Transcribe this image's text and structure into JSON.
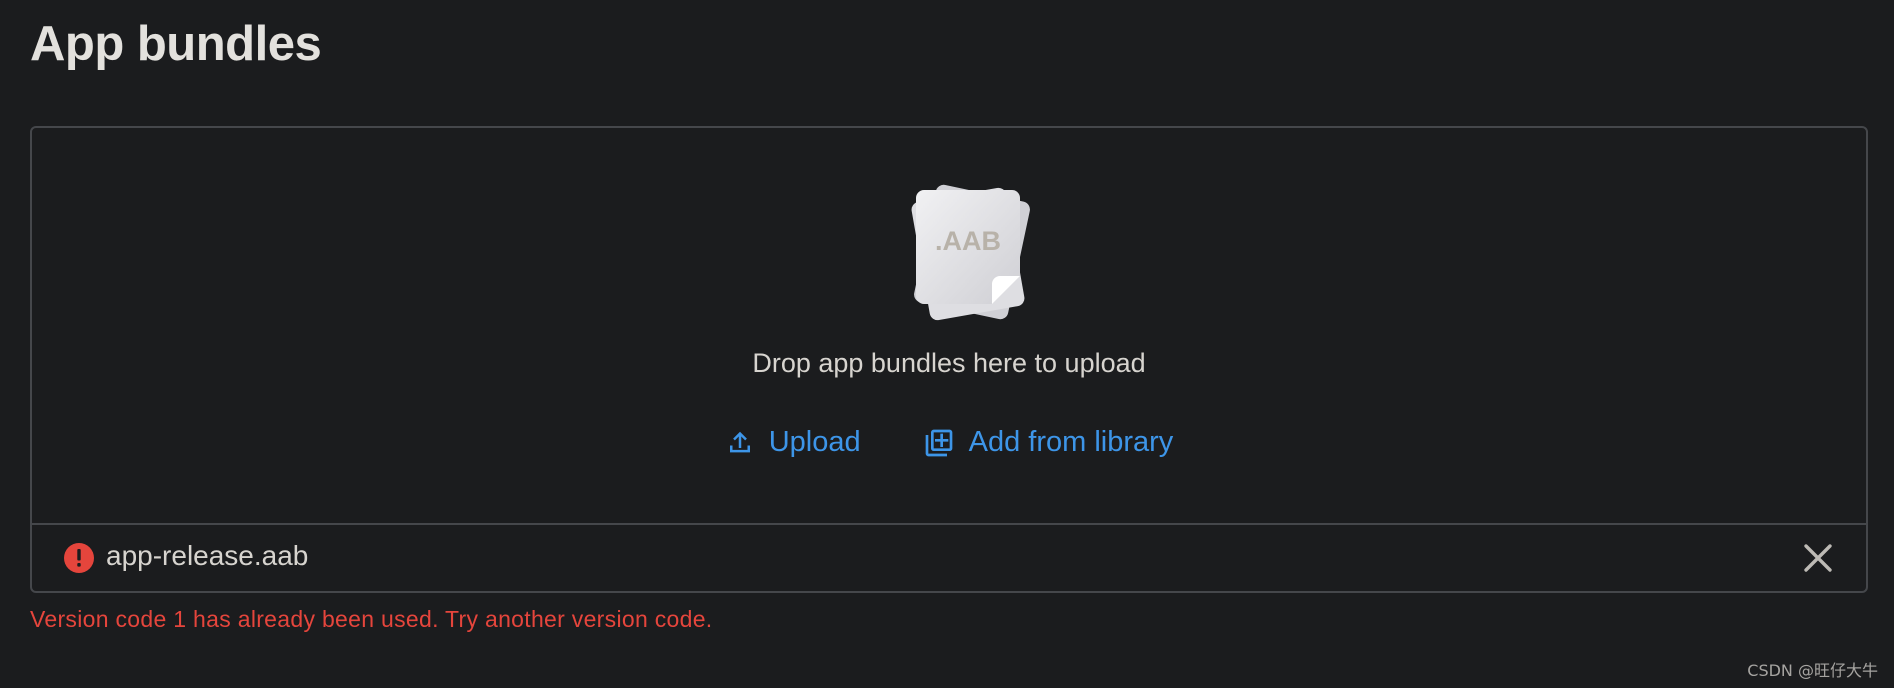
{
  "page": {
    "title": "App bundles"
  },
  "upload_card": {
    "illustration": {
      "icon": "aab-file-icon",
      "label": ".AAB"
    },
    "drop_text": "Drop app bundles here to upload",
    "actions": [
      {
        "label": "Upload",
        "icon": "upload-icon"
      },
      {
        "label": "Add from library",
        "icon": "library-add-icon"
      }
    ],
    "file": {
      "name": "app-release.aab",
      "status_icon": "error-icon",
      "remove_icon": "close-icon"
    }
  },
  "error_message": "Version code 1 has already been used. Try another version code.",
  "watermark": "CSDN @旺仔大牛",
  "colors": {
    "background": "#1b1c1e",
    "accent": "#3d95e8",
    "error": "#e5453c",
    "text": "#e3e1dd",
    "border": "#45474b"
  }
}
